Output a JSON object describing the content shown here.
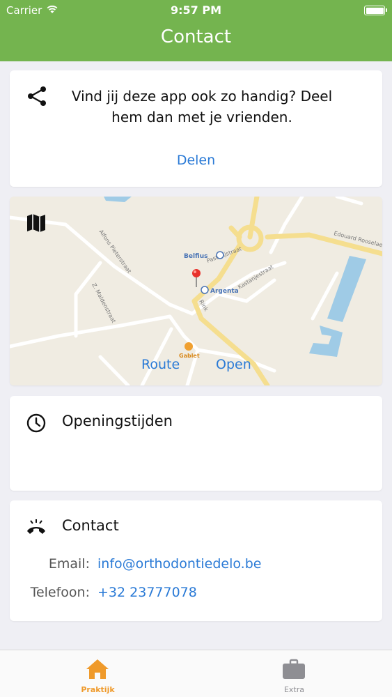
{
  "status_bar": {
    "carrier": "Carrier",
    "time": "9:57 PM"
  },
  "header": {
    "title": "Contact"
  },
  "share_card": {
    "icon": "share-icon",
    "text": "Vind jij deze app ook zo handig? Deel hem dan met je vrienden.",
    "link_label": "Delen"
  },
  "map_card": {
    "icon": "map-icon",
    "route_label": "Route",
    "open_label": "Open",
    "places": {
      "belfius": "Belfius",
      "argenta": "Argenta",
      "gablet": "Gablet",
      "pastorijstraat": "Pastorijstraat",
      "edouard": "Edouard Rooselaers",
      "kastanjestraat": "Kastanjestraat",
      "pieterstraat": "Alfons Pieterstraat",
      "mlaaenstraat": "Z. Maldenstraat",
      "rink": "Rink"
    }
  },
  "hours_card": {
    "icon": "clock-icon",
    "title": "Openingstijden"
  },
  "contact_card": {
    "icon": "phone-icon",
    "title": "Contact",
    "email_label": "Email:",
    "email_value": "info@orthodontiedelo.be",
    "phone_label": "Telefoon:",
    "phone_value": "+32 23777078"
  },
  "tabbar": {
    "tabs": [
      {
        "label": "Praktijk",
        "icon": "home-icon",
        "active": true
      },
      {
        "label": "Extra",
        "icon": "briefcase-icon",
        "active": false
      }
    ]
  },
  "colors": {
    "header_bg": "#74b44f",
    "link": "#2a7ad6",
    "tab_active": "#ef9a2b",
    "tab_inactive": "#8e8e93"
  }
}
